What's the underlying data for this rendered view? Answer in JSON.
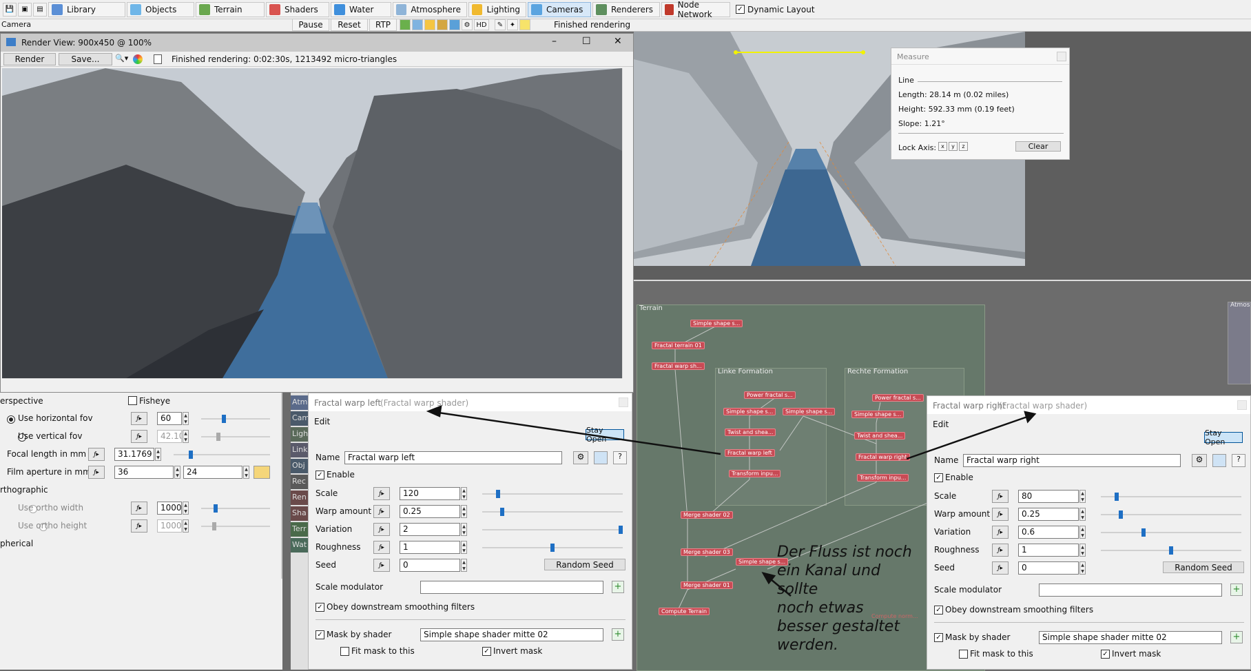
{
  "toolbar": {
    "tabs": [
      {
        "label": "Library",
        "icon": "library-icon"
      },
      {
        "label": "Objects",
        "icon": "objects-icon"
      },
      {
        "label": "Terrain",
        "icon": "terrain-icon"
      },
      {
        "label": "Shaders",
        "icon": "shaders-icon"
      },
      {
        "label": "Water",
        "icon": "water-icon"
      },
      {
        "label": "Atmosphere",
        "icon": "atmosphere-icon"
      },
      {
        "label": "Lighting",
        "icon": "lighting-icon"
      },
      {
        "label": "Cameras",
        "icon": "cameras-icon"
      },
      {
        "label": "Renderers",
        "icon": "renderers-icon"
      },
      {
        "label": "Node Network",
        "icon": "node-network-icon"
      }
    ],
    "dynamic_layout": "Dynamic Layout",
    "camera_label": "Camera",
    "pause": "Pause",
    "reset": "Reset",
    "rtp": "RTP",
    "hd": "HD",
    "status": "Finished rendering"
  },
  "render_view": {
    "title": "Render View: 900x450 @ 100%",
    "render": "Render",
    "save": "Save...",
    "status": "Finished rendering: 0:02:30s, 1213492 micro-triangles"
  },
  "measure": {
    "title": "Measure",
    "section": "Line",
    "length": "Length: 28.14 m  (0.02 miles)",
    "height": "Height: 592.33 mm  (0.19 feet)",
    "slope": "Slope: 1.21°",
    "lock_axis": "Lock Axis:",
    "x": "x",
    "y": "y",
    "z": "z",
    "clear": "Clear"
  },
  "camera_panel": {
    "perspective": "erspective",
    "fisheye": "Fisheye",
    "use_hfov": "Use horizontal fov",
    "hfov": "60",
    "use_vfov": "Use vertical fov",
    "vfov": "42.103",
    "focal_label": "Focal length in mm",
    "focal": "31.1769",
    "aperture_label": "Film aperture in mm",
    "aperture_w": "36",
    "aperture_h": "24",
    "orthographic": "rthographic",
    "ortho_width": "Use ortho width",
    "ortho_width_val": "1000",
    "ortho_height": "Use ortho height",
    "ortho_height_val": "1000",
    "spherical": "pherical"
  },
  "side_tabs": [
    "Atm",
    "Cam",
    "Ligh",
    "Link",
    "Obj",
    "Rec",
    "Ren",
    "Sha",
    "Terr",
    "Wat"
  ],
  "left_shader": {
    "title": "Fractal warp left",
    "type": "(Fractal warp shader)",
    "edit": "Edit",
    "stay_open": "Stay Open",
    "name_label": "Name",
    "name": "Fractal warp left",
    "enable": "Enable",
    "scale_label": "Scale",
    "scale": "120",
    "warp_label": "Warp amount",
    "warp": "0.25",
    "variation_label": "Variation",
    "variation": "2",
    "roughness_label": "Roughness",
    "roughness": "1",
    "seed_label": "Seed",
    "seed": "0",
    "random_seed": "Random Seed",
    "scale_mod_label": "Scale modulator",
    "obey": "Obey downstream smoothing filters",
    "mask_label": "Mask by shader",
    "mask": "Simple shape shader mitte 02",
    "fit_mask": "Fit mask to this",
    "invert_mask": "Invert mask",
    "slider_levels": [
      0.1,
      0.13,
      1.0,
      0.5
    ]
  },
  "right_shader": {
    "title": "Fractal warp right",
    "type": "(Fractal warp shader)",
    "edit": "Edit",
    "stay_open": "Stay Open",
    "name_label": "Name",
    "name": "Fractal warp right",
    "enable": "Enable",
    "scale_label": "Scale",
    "scale": "80",
    "warp_label": "Warp amount",
    "warp": "0.25",
    "variation_label": "Variation",
    "variation": "0.6",
    "roughness_label": "Roughness",
    "roughness": "1",
    "seed_label": "Seed",
    "seed": "0",
    "random_seed": "Random Seed",
    "scale_mod_label": "Scale modulator",
    "obey": "Obey downstream smoothing filters",
    "mask_label": "Mask by shader",
    "mask": "Simple shape shader mitte 02",
    "fit_mask": "Fit mask to this",
    "invert_mask": "Invert mask",
    "slider_levels": [
      0.1,
      0.13,
      0.3,
      0.5
    ]
  },
  "node_network": {
    "terrain": "Terrain",
    "linke": "Linke Formation",
    "rechte": "Rechte Formation",
    "atmos": "Atmos",
    "nodes": [
      "Simple shape s...",
      "Fractal terrain 01",
      "Fractal warp sh...",
      "Power fractal s...",
      "Simple shape s...",
      "Simple shape s...",
      "Twist and shea...",
      "Fractal warp left",
      "Transform inpu...",
      "Power fractal s...",
      "Simple shape s...",
      "Twist and shea...",
      "Fractal warp right",
      "Transform inpu...",
      "Merge shader 02",
      "Merge shader 03",
      "Simple shape s...",
      "Merge shader 01",
      "Compute Terrain",
      "Compute norm..."
    ]
  },
  "annotation": {
    "lines": [
      "Der Fluss ist noch",
      "ein Kanal und sollte",
      "noch etwas",
      "besser gestaltet",
      "werden."
    ]
  }
}
